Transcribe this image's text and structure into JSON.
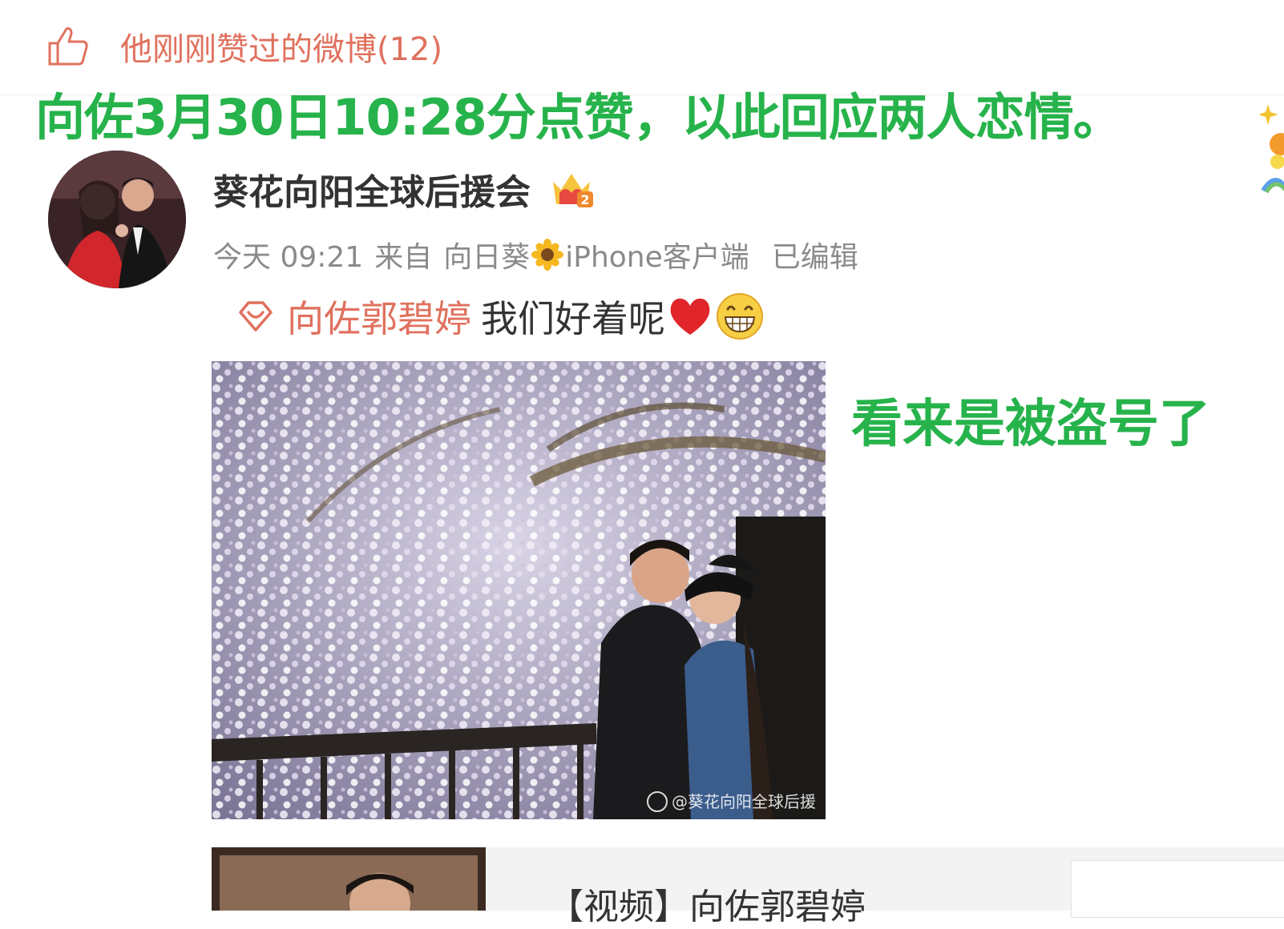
{
  "liked_header": {
    "label": "他刚刚赞过的微博(12)",
    "icon": "thumbs-up-icon"
  },
  "captions": {
    "top": "向佐3月30日10:28分点赞，以此回应两人恋情。",
    "side": "看来是被盗号了"
  },
  "post": {
    "username": "葵花向阳全球后援会",
    "time": "今天 09:21",
    "from_label": "来自",
    "source_prefix": "向日葵",
    "source_suffix": "iPhone客户端",
    "edited": "已编辑",
    "topic": "向佐郭碧婷",
    "text": "我们好着呢",
    "watermark": "@葵花向阳全球后援"
  },
  "linked_card": {
    "title": "【视频】向佐郭碧婷"
  },
  "colors": {
    "accent": "#e0715e",
    "caption_green": "#27b34b",
    "text": "#333333",
    "meta": "#8a8a8a"
  }
}
